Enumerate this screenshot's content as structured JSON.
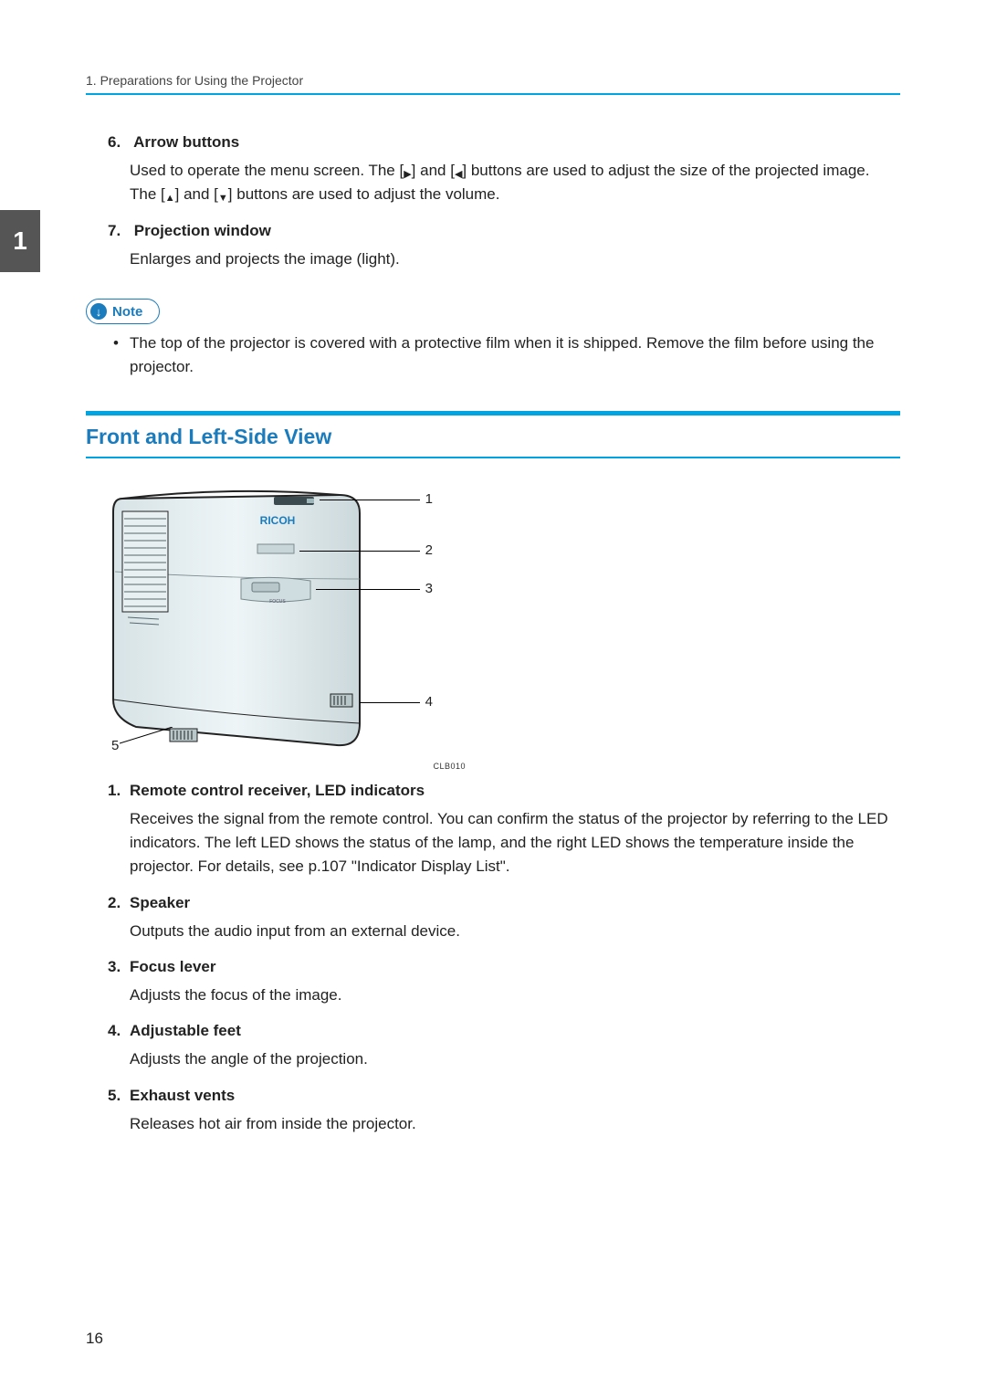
{
  "running_head": "1. Preparations for Using the Projector",
  "side_tab": "1",
  "page_number": "16",
  "items_top": [
    {
      "num": "6.",
      "title": "Arrow buttons",
      "body_pre": "Used to operate the menu screen. The [",
      "icon1": "▶",
      "body_mid1": "] and [",
      "icon2": "◀",
      "body_mid2": "] buttons are used to adjust the size of the projected image. The [",
      "icon3": "▲",
      "body_mid3": "] and [",
      "icon4": "▼",
      "body_end": "] buttons are used to adjust the volume."
    },
    {
      "num": "7.",
      "title": "Projection window",
      "body": "Enlarges and projects the image (light)."
    }
  ],
  "note_label": "Note",
  "note_icon": "↓",
  "note_body": "The top of the projector is covered with a protective film when it is shipped. Remove the film before using the projector.",
  "section_title": "Front and Left-Side View",
  "diagram": {
    "brand": "RICOH",
    "ref": "CLB010",
    "callouts": {
      "c1": "1",
      "c2": "2",
      "c3": "3",
      "c4": "4",
      "c5": "5"
    }
  },
  "items_bottom": [
    {
      "num": "1.",
      "title": "Remote control receiver, LED indicators",
      "body": "Receives the signal from the remote control. You can confirm the status of the projector by referring to the LED indicators. The left LED shows the status of the lamp, and the right LED shows the temperature inside the projector. For details, see p.107 \"Indicator Display List\"."
    },
    {
      "num": "2.",
      "title": "Speaker",
      "body": "Outputs the audio input from an external device."
    },
    {
      "num": "3.",
      "title": "Focus lever",
      "body": "Adjusts the focus of the image."
    },
    {
      "num": "4.",
      "title": "Adjustable feet",
      "body": "Adjusts the angle of the projection."
    },
    {
      "num": "5.",
      "title": "Exhaust vents",
      "body": "Releases hot air from inside the projector."
    }
  ]
}
